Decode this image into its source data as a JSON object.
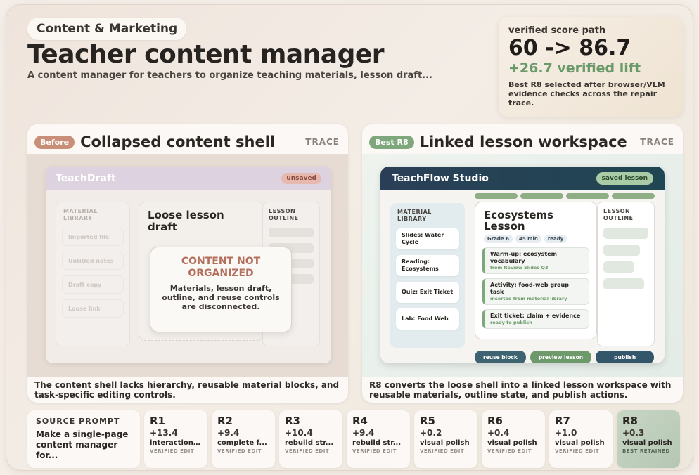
{
  "header": {
    "category": "Content & Marketing",
    "title": "Teacher content manager",
    "subtitle": "A content manager for teachers to organize teaching materials, lesson draft..."
  },
  "score": {
    "label": "verified score path",
    "path": "60 -> 86.7",
    "lift": "+26.7 verified lift",
    "note": "Best R8 selected after browser/VLM evidence checks across the repair trace."
  },
  "before": {
    "badge": "Before",
    "title": "Collapsed content shell",
    "trace": "TRACE",
    "caption": "The content shell lacks hierarchy, reusable material blocks, and task-specific editing controls.",
    "mock": {
      "brand": "TeachDraft",
      "status": "unsaved",
      "library_title": "MATERIAL LIBRARY",
      "library_items": [
        "Imported file",
        "Untitled notes",
        "Draft copy",
        "Loose link"
      ],
      "draft_title": "Loose lesson draft",
      "outline_title": "LESSON OUTLINE",
      "warning_title": "CONTENT NOT ORGANIZED",
      "warning_body": "Materials, lesson draft, outline, and reuse controls are disconnected."
    }
  },
  "after": {
    "badge": "Best R8",
    "title": "Linked lesson workspace",
    "trace": "TRACE",
    "caption": "R8 converts the loose shell into a linked lesson workspace with reusable materials, outline state, and publish actions.",
    "mock": {
      "brand": "TeachFlow Studio",
      "status": "saved lesson",
      "library_title": "MATERIAL LIBRARY",
      "library_items": [
        "Slides: Water Cycle",
        "Reading: Ecosystems",
        "Quiz: Exit Ticket",
        "Lab: Food Web"
      ],
      "lesson_title": "Ecosystems Lesson",
      "chips": [
        "Grade 6",
        "45 min",
        "ready"
      ],
      "steps": [
        {
          "title": "Warm-up: ecosystem vocabulary",
          "sub": "from Review Slides Q3"
        },
        {
          "title": "Activity: food-web group task",
          "sub": "inserted from material library"
        },
        {
          "title": "Exit ticket: claim + evidence",
          "sub": "ready to publish"
        }
      ],
      "outline_title": "LESSON OUTLINE",
      "actions": {
        "reuse": "reuse block",
        "preview": "preview lesson",
        "publish": "publish"
      }
    }
  },
  "source": {
    "title": "SOURCE PROMPT",
    "text": "Make a single-page content manager for..."
  },
  "rounds": [
    {
      "name": "R1",
      "delta": "+13.4",
      "desc": "interaction ...",
      "status": "VERIFIED EDIT"
    },
    {
      "name": "R2",
      "delta": "+9.4",
      "desc": "complete f...",
      "status": "VERIFIED EDIT"
    },
    {
      "name": "R3",
      "delta": "+10.4",
      "desc": "rebuild str...",
      "status": "VERIFIED EDIT"
    },
    {
      "name": "R4",
      "delta": "+9.4",
      "desc": "rebuild str...",
      "status": "VERIFIED EDIT"
    },
    {
      "name": "R5",
      "delta": "+0.2",
      "desc": "visual polish",
      "status": "VERIFIED EDIT"
    },
    {
      "name": "R6",
      "delta": "+0.4",
      "desc": "visual polish",
      "status": "VERIFIED EDIT"
    },
    {
      "name": "R7",
      "delta": "+1.0",
      "desc": "visual polish",
      "status": "VERIFIED EDIT"
    },
    {
      "name": "R8",
      "delta": "+0.3",
      "desc": "visual polish",
      "status": "BEST RETAINED"
    }
  ]
}
